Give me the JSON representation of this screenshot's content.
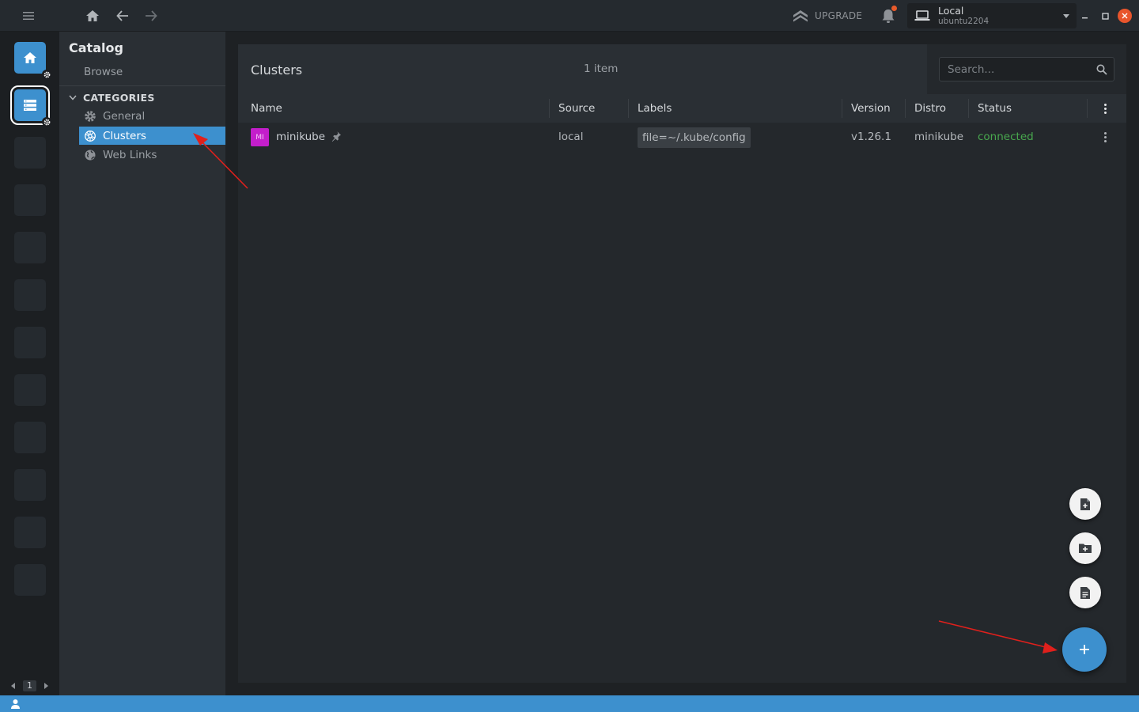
{
  "topbar": {
    "upgrade_label": "UPGRADE",
    "cluster_name": "Local",
    "cluster_host": "ubuntu2204",
    "icons": [
      "menu-icon",
      "home-icon",
      "back-arrow-icon",
      "forward-arrow-icon",
      "upgrade-icon",
      "bell-icon",
      "laptop-icon",
      "chevron-down-icon",
      "minimize-icon",
      "maximize-icon",
      "close-icon"
    ],
    "colors": {
      "notification_dot": "#e85a2a",
      "close_button": "#e8552c"
    }
  },
  "hotbar": {
    "page_number": "1",
    "active_color": "#3d90ce"
  },
  "sidebar": {
    "title": "Catalog",
    "browse_label": "Browse",
    "categories_label": "CATEGORIES",
    "items": [
      {
        "label": "General",
        "icon": "gear-icon"
      },
      {
        "label": "Clusters",
        "icon": "kubernetes-icon",
        "active": true
      },
      {
        "label": "Web Links",
        "icon": "globe-icon"
      }
    ]
  },
  "main": {
    "title": "Clusters",
    "item_count": "1 item",
    "search_placeholder": "Search...",
    "columns": [
      "Name",
      "Source",
      "Labels",
      "Version",
      "Distro",
      "Status"
    ],
    "rows": [
      {
        "avatar_text": "MI",
        "avatar_color": "#c41ecb",
        "name": "minikube",
        "source": "local",
        "label": "file=~/.kube/config",
        "version": "v1.26.1",
        "distro": "minikube",
        "status": "connected",
        "status_color": "#48a84e"
      }
    ]
  },
  "fab": {
    "actions": [
      "add-kubeconfig-file-icon",
      "add-folder-icon",
      "paste-kubeconfig-icon"
    ],
    "main_icon": "plus-icon",
    "color": "#3d90ce"
  },
  "annotation_color": "#e0201c"
}
